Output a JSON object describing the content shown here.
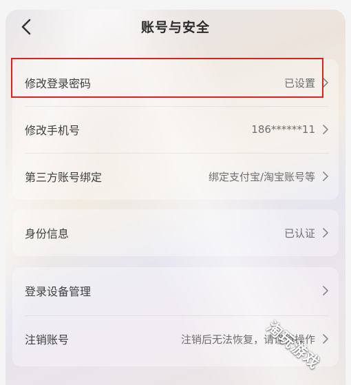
{
  "header": {
    "title": "账号与安全",
    "back_icon": "chevron-left-icon"
  },
  "groups": [
    {
      "items": [
        {
          "label": "修改登录密码",
          "value": "已设置"
        },
        {
          "label": "修改手机号",
          "value": "186******11"
        },
        {
          "label": "第三方账号绑定",
          "value": "绑定支付宝/淘宝账号等"
        }
      ]
    },
    {
      "items": [
        {
          "label": "身份信息",
          "value": "已认证"
        }
      ]
    },
    {
      "items": [
        {
          "label": "登录设备管理",
          "value": ""
        },
        {
          "label": "注销账号",
          "value": "注销后无法恢复，请谨慎操作"
        }
      ]
    }
  ],
  "watermark": "淘玩游戏",
  "colors": {
    "highlight_border": "#e02020",
    "label_text": "#3e3e3e",
    "value_text": "#6e6e6e"
  }
}
